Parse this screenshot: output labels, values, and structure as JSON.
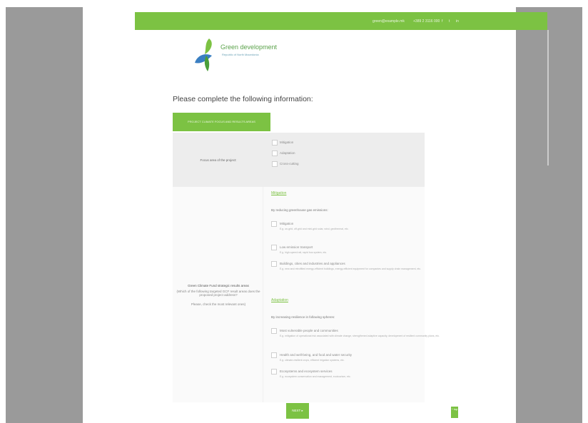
{
  "topbar": {
    "email": "green@example.mk",
    "phone": "+389 2 3116 000",
    "social": [
      "f",
      "t",
      "in"
    ]
  },
  "logo": {
    "title": "Green development",
    "subtitle": "Republic of North Macedonia"
  },
  "heading": "Please complete the following information:",
  "tab_label": "PROJECT CLIMATE FOCUS AND RESULTS AREAS",
  "focus": {
    "label": "Focus area of the project:",
    "options": [
      "Mitigation",
      "Adaptation",
      "Cross-cutting"
    ]
  },
  "results": {
    "label_title": "Green Climate Fund strategic results areas",
    "label_body": "(Which of the following targeted GCF result areas does the proposed project address?",
    "label_note": "Please, check the most relevant ones)",
    "mitigation_heading": "Mitigation",
    "mitigation_intro": "By reducing greenhouse gas emissions:",
    "mitigation_options": [
      {
        "label": "Mitigation",
        "sub": "E.g. on-grid, off-grid and mini-grid solar, wind, geothermal, etc."
      },
      {
        "label": "Low emission transport",
        "sub": "E.g. high-speed rail, rapid bus system, etc."
      },
      {
        "label": "Buildings, cities and industries and appliances",
        "sub": "E.g. new and retrofitted energy-efficient buildings, energy-efficient equipment for companies and supply chain management, etc."
      }
    ],
    "adaptation_heading": "Adaptation",
    "adaptation_intro": "By increasing resilience in following spheres:",
    "adaptation_options": [
      {
        "label": "Most vulnerable people and communities",
        "sub": "E.g. mitigation of operational risk associated with climate change, strengthened adaptive capacity, development of resilient community plans, etc."
      },
      {
        "label": "Health and well-being, and food and water security",
        "sub": "E.g. climate-resilient crops, efficient irrigation systems, etc."
      },
      {
        "label": "Ecosystems and ecosystem services",
        "sub": "E.g. ecosystem conservation and management, ecotourism, etc."
      }
    ]
  },
  "next_label": "NEXT ▸",
  "scroll_top_label": "^ top"
}
